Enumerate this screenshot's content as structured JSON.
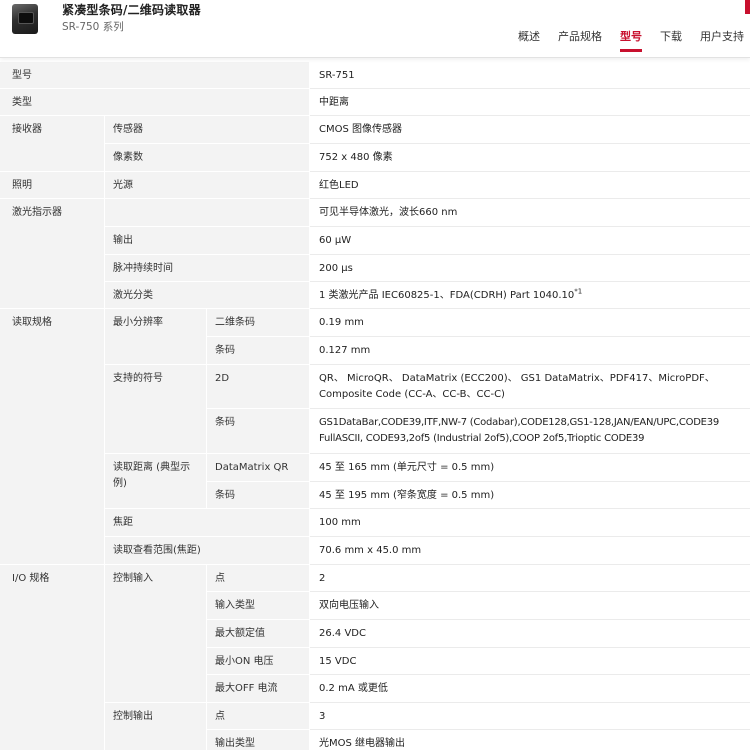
{
  "header": {
    "title": "紧凑型条码/二维码读取器",
    "subtitle": "SR-750 系列",
    "tabs": [
      {
        "label": "概述"
      },
      {
        "label": "产品规格"
      },
      {
        "label": "型号"
      },
      {
        "label": "下载"
      },
      {
        "label": "用户支持"
      }
    ],
    "active_tab": "型号",
    "accent_color": "#c8102e"
  },
  "specs": {
    "model": {
      "label": "型号",
      "value": "SR-751"
    },
    "type": {
      "label": "类型",
      "value": "中距离"
    },
    "receiver": {
      "label": "接收器",
      "sensor": {
        "label": "传感器",
        "value": "CMOS 图像传感器"
      },
      "pixels": {
        "label": "像素数",
        "value": "752 x 480 像素"
      }
    },
    "lighting": {
      "label": "照明",
      "light_source": {
        "label": "光源",
        "value": "红色LED"
      }
    },
    "laser": {
      "label": "激光指示器",
      "row0_value": "可见半导体激光，波长660 nm",
      "output": {
        "label": "输出",
        "value": "60 μW"
      },
      "pulse": {
        "label": "脉冲持续时间",
        "value": "200 μs"
      },
      "class": {
        "label": "激光分类",
        "value": "1 类激光产品 IEC60825-1、FDA(CDRH) Part 1040.10",
        "sup": "*1"
      }
    },
    "reading": {
      "label": "读取规格",
      "min_resolution": {
        "label": "最小分辨率",
        "twod": {
          "label": "二维条码",
          "value": "0.19 mm"
        },
        "barcode": {
          "label": "条码",
          "value": "0.127 mm"
        }
      },
      "symbols": {
        "label": "支持的符号",
        "twod": {
          "label": "2D",
          "value": "QR、 MicroQR、 DataMatrix (ECC200)、 GS1 DataMatrix、PDF417、MicroPDF、 Composite Code (CC-A、CC-B、CC-C)"
        },
        "barcode": {
          "label": "条码",
          "value": "GS1DataBar,CODE39,ITF,NW-7 (Codabar),CODE128,GS1-128,JAN/EAN/UPC,CODE39 FullASCII, CODE93,2of5 (Industrial 2of5),COOP 2of5,Trioptic CODE39"
        }
      },
      "distance": {
        "label": "读取距离 (典型示例)",
        "dm_qr": {
          "label": "DataMatrix QR",
          "value": "45 至 165 mm (单元尺寸 = 0.5 mm)"
        },
        "barcode": {
          "label": "条码",
          "value": "45 至 195 mm (窄条宽度 = 0.5 mm)"
        }
      },
      "focal": {
        "label": "焦距",
        "value": "100 mm"
      },
      "field_of_view": {
        "label": "读取查看范围(焦距)",
        "value": "70.6 mm x 45.0 mm"
      }
    },
    "io": {
      "label": "I/O 规格",
      "control_input": {
        "label": "控制输入",
        "points": {
          "label": "点",
          "value": "2"
        },
        "input_type": {
          "label": "输入类型",
          "value": "双向电压输入"
        },
        "max_rating": {
          "label": "最大额定值",
          "value": "26.4 VDC"
        },
        "min_on": {
          "label": "最小ON 电压",
          "value": "15 VDC"
        },
        "max_off": {
          "label": "最大OFF 电流",
          "value": "0.2 mA 或更低"
        }
      },
      "control_output": {
        "label": "控制输出",
        "points": {
          "label": "点",
          "value": "3"
        },
        "output_type": {
          "label": "输出类型",
          "value": "光MOS 继电器输出"
        }
      }
    }
  }
}
